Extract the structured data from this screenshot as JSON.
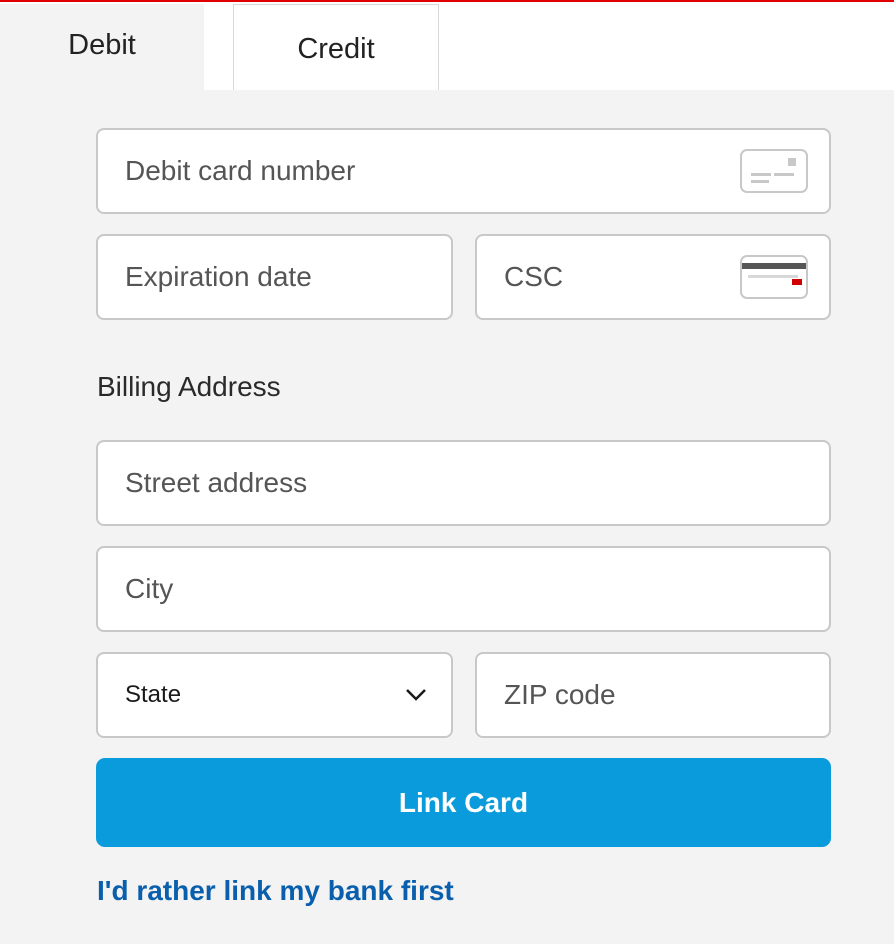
{
  "tabs": [
    {
      "label": "Debit",
      "selected": true
    },
    {
      "label": "Credit",
      "selected": false
    }
  ],
  "form": {
    "card_number_placeholder": "Debit card number",
    "expiration_placeholder": "Expiration date",
    "csc_placeholder": "CSC",
    "billing_label": "Billing Address",
    "street_placeholder": "Street address",
    "city_placeholder": "City",
    "state_select": "State",
    "zip_placeholder": "ZIP code",
    "submit_label": "Link Card",
    "alt_link_label": "I'd rather link my bank first"
  },
  "colors": {
    "accent": "#0a9bdc",
    "link": "#0a5fad",
    "background": "#f3f3f3",
    "field_border": "#c8c8c8",
    "top_line": "#e00000"
  },
  "icons": {
    "card_number": "card-front-icon",
    "csc": "card-back-icon",
    "state": "chevron-down-icon"
  }
}
